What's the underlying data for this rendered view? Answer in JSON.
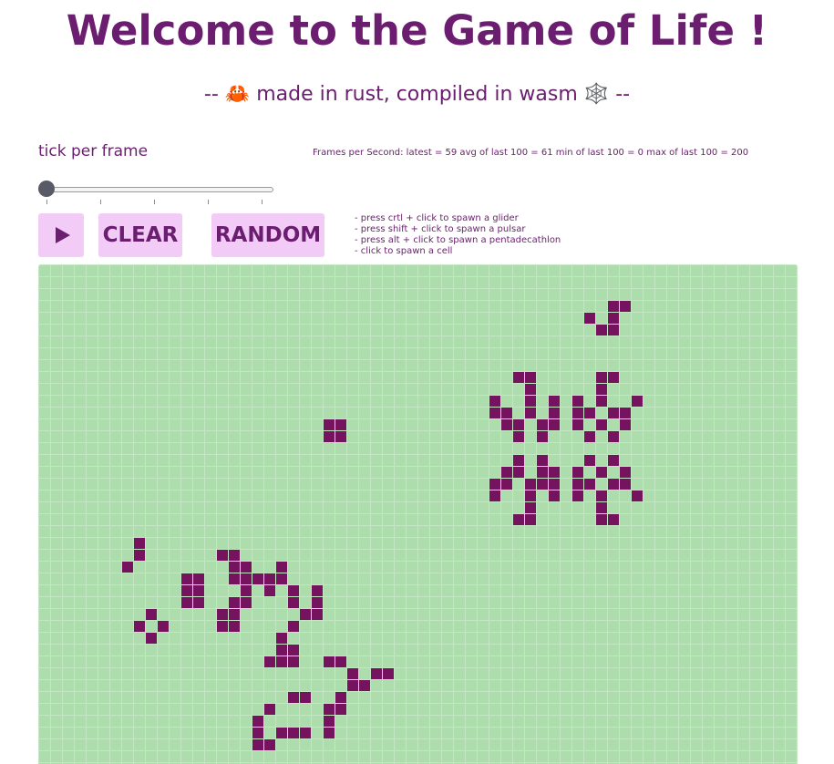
{
  "header": {
    "title": "Welcome to the Game of Life !",
    "subtitle_prefix": "--",
    "subtitle_crab": "🦀",
    "subtitle_text": "made in rust, compiled in wasm",
    "subtitle_web": "🕸️",
    "subtitle_suffix": "--"
  },
  "controls": {
    "tick_label": "tick per frame",
    "tick_value": 0,
    "tick_range": [
      1,
      5
    ],
    "fps_text": "Frames per Second: latest = 59 avg of last 100 = 61 min of last 100 = 0 max of last 100 = 200",
    "play_icon": "play-icon",
    "clear_label": "CLEAR",
    "random_label": "RANDOM"
  },
  "help": [
    "- press crtl + click to spawn a glider",
    "- press shift + click to spawn a pulsar",
    "- press alt + click to spawn a pentadecathlon",
    "- click to spawn a cell"
  ],
  "colors": {
    "title": "#6b1d6f",
    "button_bg": "#f3cbf7",
    "board_bg": "#addcad",
    "grid_line": "#c3e7c3",
    "cell": "#76135f"
  },
  "board": {
    "cols": 64,
    "rows": 42,
    "alive_cells": [
      [
        48,
        3
      ],
      [
        49,
        3
      ],
      [
        46,
        4
      ],
      [
        48,
        4
      ],
      [
        47,
        5
      ],
      [
        48,
        5
      ],
      [
        40,
        9
      ],
      [
        41,
        9
      ],
      [
        47,
        9
      ],
      [
        48,
        9
      ],
      [
        41,
        10
      ],
      [
        47,
        10
      ],
      [
        38,
        11
      ],
      [
        41,
        11
      ],
      [
        43,
        11
      ],
      [
        45,
        11
      ],
      [
        47,
        11
      ],
      [
        50,
        11
      ],
      [
        38,
        12
      ],
      [
        39,
        12
      ],
      [
        41,
        12
      ],
      [
        43,
        12
      ],
      [
        45,
        12
      ],
      [
        46,
        12
      ],
      [
        48,
        12
      ],
      [
        49,
        12
      ],
      [
        39,
        13
      ],
      [
        40,
        13
      ],
      [
        42,
        13
      ],
      [
        43,
        13
      ],
      [
        45,
        13
      ],
      [
        47,
        13
      ],
      [
        49,
        13
      ],
      [
        40,
        14
      ],
      [
        42,
        14
      ],
      [
        46,
        14
      ],
      [
        48,
        14
      ],
      [
        24,
        13
      ],
      [
        25,
        13
      ],
      [
        24,
        14
      ],
      [
        25,
        14
      ],
      [
        40,
        16
      ],
      [
        42,
        16
      ],
      [
        46,
        16
      ],
      [
        48,
        16
      ],
      [
        39,
        17
      ],
      [
        40,
        17
      ],
      [
        42,
        17
      ],
      [
        43,
        17
      ],
      [
        45,
        17
      ],
      [
        47,
        17
      ],
      [
        49,
        17
      ],
      [
        38,
        18
      ],
      [
        39,
        18
      ],
      [
        41,
        18
      ],
      [
        42,
        18
      ],
      [
        43,
        18
      ],
      [
        45,
        18
      ],
      [
        46,
        18
      ],
      [
        48,
        18
      ],
      [
        49,
        18
      ],
      [
        38,
        19
      ],
      [
        41,
        19
      ],
      [
        43,
        19
      ],
      [
        45,
        19
      ],
      [
        47,
        19
      ],
      [
        50,
        19
      ],
      [
        41,
        20
      ],
      [
        47,
        20
      ],
      [
        40,
        21
      ],
      [
        41,
        21
      ],
      [
        47,
        21
      ],
      [
        48,
        21
      ],
      [
        8,
        23
      ],
      [
        8,
        24
      ],
      [
        7,
        25
      ],
      [
        15,
        24
      ],
      [
        16,
        24
      ],
      [
        16,
        25
      ],
      [
        17,
        25
      ],
      [
        20,
        25
      ],
      [
        12,
        26
      ],
      [
        13,
        26
      ],
      [
        16,
        26
      ],
      [
        17,
        26
      ],
      [
        18,
        26
      ],
      [
        19,
        26
      ],
      [
        20,
        26
      ],
      [
        12,
        27
      ],
      [
        13,
        27
      ],
      [
        17,
        27
      ],
      [
        19,
        27
      ],
      [
        21,
        27
      ],
      [
        23,
        27
      ],
      [
        12,
        28
      ],
      [
        13,
        28
      ],
      [
        16,
        28
      ],
      [
        17,
        28
      ],
      [
        21,
        28
      ],
      [
        23,
        28
      ],
      [
        22,
        29
      ],
      [
        23,
        29
      ],
      [
        9,
        29
      ],
      [
        8,
        30
      ],
      [
        10,
        30
      ],
      [
        9,
        31
      ],
      [
        15,
        29
      ],
      [
        16,
        29
      ],
      [
        15,
        30
      ],
      [
        16,
        30
      ],
      [
        21,
        30
      ],
      [
        20,
        31
      ],
      [
        20,
        32
      ],
      [
        21,
        32
      ],
      [
        19,
        33
      ],
      [
        20,
        33
      ],
      [
        21,
        33
      ],
      [
        24,
        33
      ],
      [
        25,
        33
      ],
      [
        26,
        34
      ],
      [
        28,
        34
      ],
      [
        29,
        34
      ],
      [
        26,
        35
      ],
      [
        27,
        35
      ],
      [
        21,
        36
      ],
      [
        22,
        36
      ],
      [
        25,
        36
      ],
      [
        19,
        37
      ],
      [
        24,
        37
      ],
      [
        25,
        37
      ],
      [
        18,
        38
      ],
      [
        24,
        38
      ],
      [
        18,
        39
      ],
      [
        20,
        39
      ],
      [
        21,
        39
      ],
      [
        22,
        39
      ],
      [
        24,
        39
      ],
      [
        18,
        40
      ],
      [
        19,
        40
      ]
    ]
  }
}
